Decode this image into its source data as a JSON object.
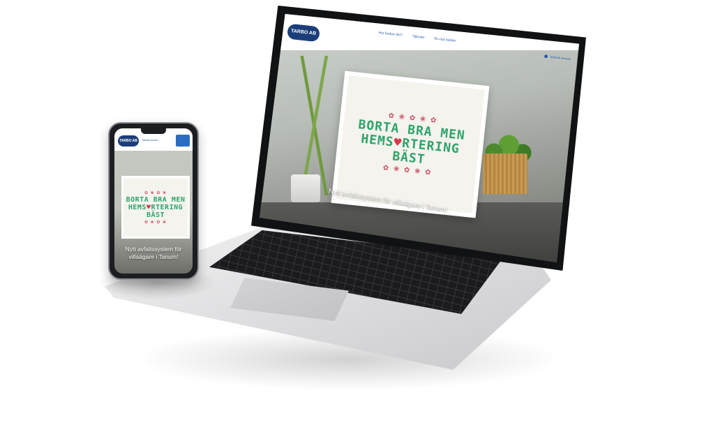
{
  "laptop_site": {
    "logo_text": "TARBO AB",
    "nav": [
      "Hur funkar det?",
      "Tjänster",
      "Ru nya kärlen"
    ],
    "login_label": "Teknisk access",
    "hero_lines": [
      "BORTA BRA MEN",
      "HEMS",
      "RTERING",
      "BÄST"
    ],
    "hero_heart": "♥",
    "flowers": "✿ ❀ ✿ ❀ ✿",
    "caption": "Nytt avfallssystem för villaägare i Tanum!"
  },
  "phone_site": {
    "logo_text": "TARBO AB",
    "login_label": "Teknisk access",
    "hero_lines": [
      "BORTA BRA MEN",
      "HEMS",
      "RTERING",
      "BÄST"
    ],
    "hero_heart": "♥",
    "flowers": "✿ ❀ ✿ ❀",
    "caption": "Nytt avfallssystem för villaägare i Tanum!"
  },
  "colors": {
    "brand_blue": "#2a5aa6",
    "logo_navy": "#1b3e7a",
    "stitch_green": "#2fa36a",
    "stitch_red": "#d23a4c"
  }
}
